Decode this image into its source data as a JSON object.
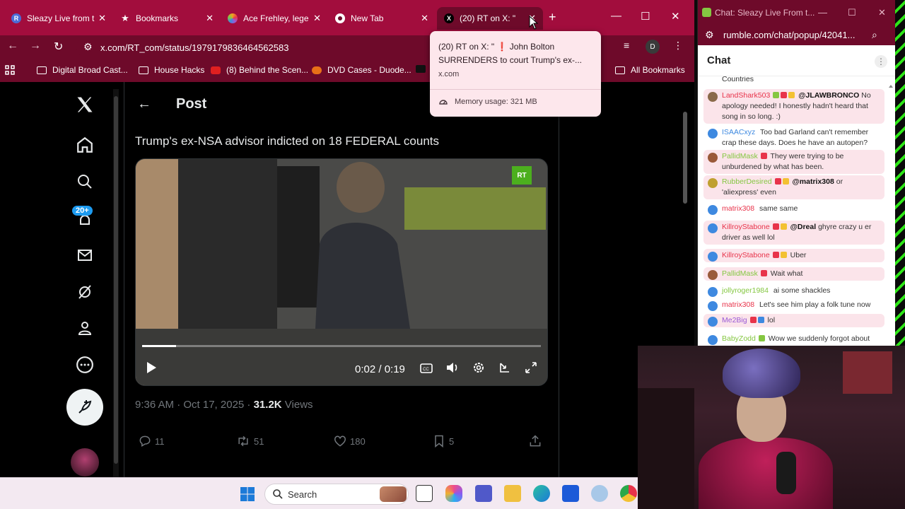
{
  "browser": {
    "tabs": [
      {
        "title": "Sleazy Live from t",
        "icon": "rumble-r-icon",
        "color": "#4b6cd6",
        "glyph": "R"
      },
      {
        "title": "Bookmarks",
        "icon": "star-icon",
        "color": "#ffffff",
        "glyph": "★"
      },
      {
        "title": "Ace Frehley, lege",
        "icon": "nbc-peacock-icon",
        "color": "#f0a020",
        "glyph": "◆"
      },
      {
        "title": "New Tab",
        "icon": "chrome-icon",
        "color": "#ffffff",
        "glyph": "◉"
      },
      {
        "title": "(20) RT on X: \"",
        "icon": "x-logo-icon",
        "color": "#000000",
        "glyph": "X"
      }
    ],
    "url": "x.com/RT_com/status/1979179836464562583",
    "profile_initial": "D",
    "bookmarks": [
      {
        "label": "Digital Broad Cast..."
      },
      {
        "label": "House Hacks"
      },
      {
        "label": "(8) Behind the Scen..."
      },
      {
        "label": "DVD Cases - Duode..."
      },
      {
        "label": "All Bookmarks"
      }
    ]
  },
  "hovercard": {
    "title": "(20) RT on X: \" ❗ John Bolton SURRENDERS to court Trump's ex-...",
    "domain": "x.com",
    "memory": "Memory usage: 321 MB"
  },
  "x_page": {
    "header": "Post",
    "notification_badge": "20+",
    "post_text": "Trump's ex-NSA advisor indicted on 18 FEDERAL counts",
    "video": {
      "watermark": "RT",
      "time": "0:02 / 0:19",
      "progress_fraction": 0.085
    },
    "meta": {
      "timestamp": "9:36 AM · Oct 17, 2025 · ",
      "views_count": "31.2K",
      "views_label": " Views"
    },
    "actions": {
      "replies": "11",
      "reposts": "51",
      "likes": "180",
      "bookmarks": "5"
    }
  },
  "chat_window": {
    "title": "Chat: Sleazy Live From t...",
    "url": "rumble.com/chat/popup/42041...",
    "heading": "Chat",
    "top_partial": "Countries",
    "messages": [
      {
        "user": "LandShark503",
        "color": "#e8334a",
        "av": "#8a6a4a",
        "badges": [
          "g",
          "r",
          "y"
        ],
        "mention": "@JLAWBRONCO",
        "text": " No apology needed! I honestly hadn't heard that song in so long. :)",
        "hl": true
      },
      {
        "user": "ISAACxyz",
        "color": "#3e89e0",
        "av": "#3e89e0",
        "badges": [],
        "mention": "",
        "text": "Too bad Garland can't remember crap these days. Does he have an autopen?",
        "hl": false
      },
      {
        "user": "PallidMask",
        "color": "#85c742",
        "av": "#9a5a3a",
        "badges": [
          "r"
        ],
        "mention": "",
        "text": "They were trying to be unburdened by what has been.",
        "hl": true
      },
      {
        "user": "RubberDesired",
        "color": "#85c742",
        "av": "#c0a030",
        "badges": [
          "r",
          "y"
        ],
        "mention": "@matrix308",
        "text": " or 'aliexpress' even",
        "hl": true
      },
      {
        "user": "matrix308",
        "color": "#e8334a",
        "av": "#3e89e0",
        "badges": [],
        "mention": "",
        "text": "same same",
        "hl": false
      },
      {
        "user": "KillroyStabone",
        "color": "#e8334a",
        "av": "#3e89e0",
        "badges": [
          "r",
          "y"
        ],
        "mention": "@Dreal",
        "text": " ghyre crazy u er driver as well lol",
        "hl": true
      },
      {
        "user": "KillroyStabone",
        "color": "#e8334a",
        "av": "#3e89e0",
        "badges": [
          "r",
          "y"
        ],
        "mention": "",
        "text": "Uber",
        "hl": true
      },
      {
        "user": "PallidMask",
        "color": "#85c742",
        "av": "#9a5a3a",
        "badges": [
          "r"
        ],
        "mention": "",
        "text": "Wait what",
        "hl": true
      },
      {
        "user": "jollyroger1984",
        "color": "#85c742",
        "av": "#3e89e0",
        "badges": [],
        "mention": "",
        "text": "ai some shackles",
        "hl": false
      },
      {
        "user": "matrix308",
        "color": "#e8334a",
        "av": "#3e89e0",
        "badges": [],
        "mention": "",
        "text": "Let's see him play a folk tune now",
        "hl": false
      },
      {
        "user": "Me2Big",
        "color": "#9a5ad6",
        "av": "#3e89e0",
        "badges": [
          "r",
          "b"
        ],
        "mention": "",
        "text": "lol",
        "hl": true
      },
      {
        "user": "BabyZodd",
        "color": "#85c742",
        "av": "#3e89e0",
        "badges": [
          "g"
        ],
        "mention": "",
        "text": "Wow we suddenly forgot about",
        "hl": false
      }
    ]
  },
  "taskbar": {
    "search_placeholder": "Search"
  },
  "colors": {
    "chrome_theme": "#a20d3d",
    "chrome_toolbar": "#6e0a2a",
    "x_blue": "#1d9bf0",
    "rumble_green": "#85c742"
  }
}
